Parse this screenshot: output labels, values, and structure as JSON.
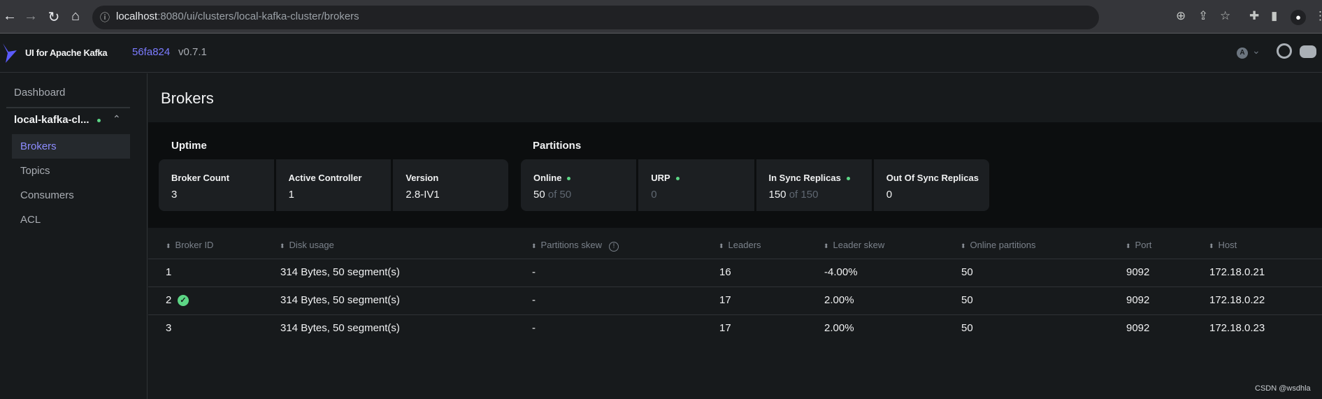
{
  "browser": {
    "url_host": "localhost",
    "url_path": ":8080/ui/clusters/local-kafka-cluster/brokers"
  },
  "header": {
    "app_name": "UI for Apache Kafka",
    "commit": "56fa824",
    "version": "v0.7.1",
    "user_initial": "A"
  },
  "sidebar": {
    "dashboard": "Dashboard",
    "cluster": "local-kafka-cl...",
    "items": [
      {
        "label": "Brokers",
        "active": true
      },
      {
        "label": "Topics"
      },
      {
        "label": "Consumers"
      },
      {
        "label": "ACL"
      }
    ]
  },
  "page": {
    "title": "Brokers"
  },
  "uptime": {
    "title": "Uptime",
    "cards": [
      {
        "label": "Broker Count",
        "value": "3"
      },
      {
        "label": "Active Controller",
        "value": "1"
      },
      {
        "label": "Version",
        "value": "2.8-IV1"
      }
    ]
  },
  "partitions": {
    "title": "Partitions",
    "cards": [
      {
        "label": "Online",
        "value": "50",
        "of": "of 50"
      },
      {
        "label": "URP",
        "value": "0"
      },
      {
        "label": "In Sync Replicas",
        "value": "150",
        "of": "of 150"
      },
      {
        "label": "Out Of Sync Replicas",
        "value": "0"
      }
    ]
  },
  "table": {
    "headers": [
      "Broker ID",
      "Disk usage",
      "Partitions skew",
      "Leaders",
      "Leader skew",
      "Online partitions",
      "Port",
      "Host"
    ],
    "rows": [
      [
        "1",
        "314 Bytes, 50 segment(s)",
        "-",
        "16",
        "-4.00%",
        "50",
        "9092",
        "172.18.0.21"
      ],
      [
        "2",
        "314 Bytes, 50 segment(s)",
        "-",
        "17",
        "2.00%",
        "50",
        "9092",
        "172.18.0.22"
      ],
      [
        "3",
        "314 Bytes, 50 segment(s)",
        "-",
        "17",
        "2.00%",
        "50",
        "9092",
        "172.18.0.23"
      ]
    ],
    "controller_row": 1
  },
  "watermark": "CSDN @wsdhla",
  "colors": {
    "accent": "#7b7bff",
    "online": "#5cd685"
  }
}
